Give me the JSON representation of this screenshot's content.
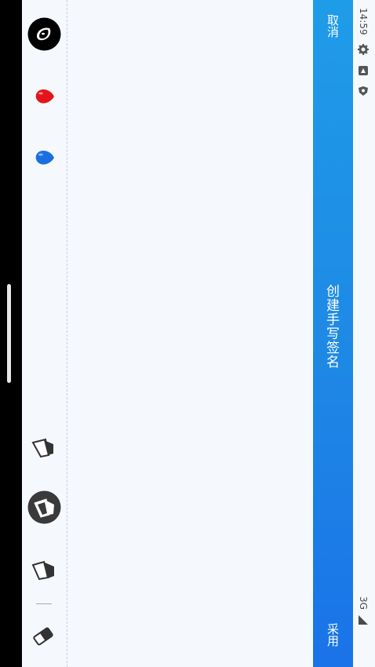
{
  "app_bar": {
    "cancel_label": "取消",
    "title": "创建手写签名",
    "apply_label": "采用"
  },
  "status_bar": {
    "time": "14:59",
    "network": "3G"
  },
  "colors": {
    "app_bar_blue": "#1e88e5",
    "ink_black": "#000000",
    "ink_red": "#e3141a",
    "ink_blue": "#1a6fe0",
    "tool_dark": "#3a3a3a"
  },
  "toolbar": {
    "color_options": [
      "black",
      "red",
      "blue"
    ],
    "selected_color": "black",
    "pen_tools": [
      "thin-pen-icon",
      "marker-pen-icon",
      "brush-pen-icon"
    ],
    "selected_tool": "marker-pen-icon",
    "eraser": "eraser-icon"
  }
}
